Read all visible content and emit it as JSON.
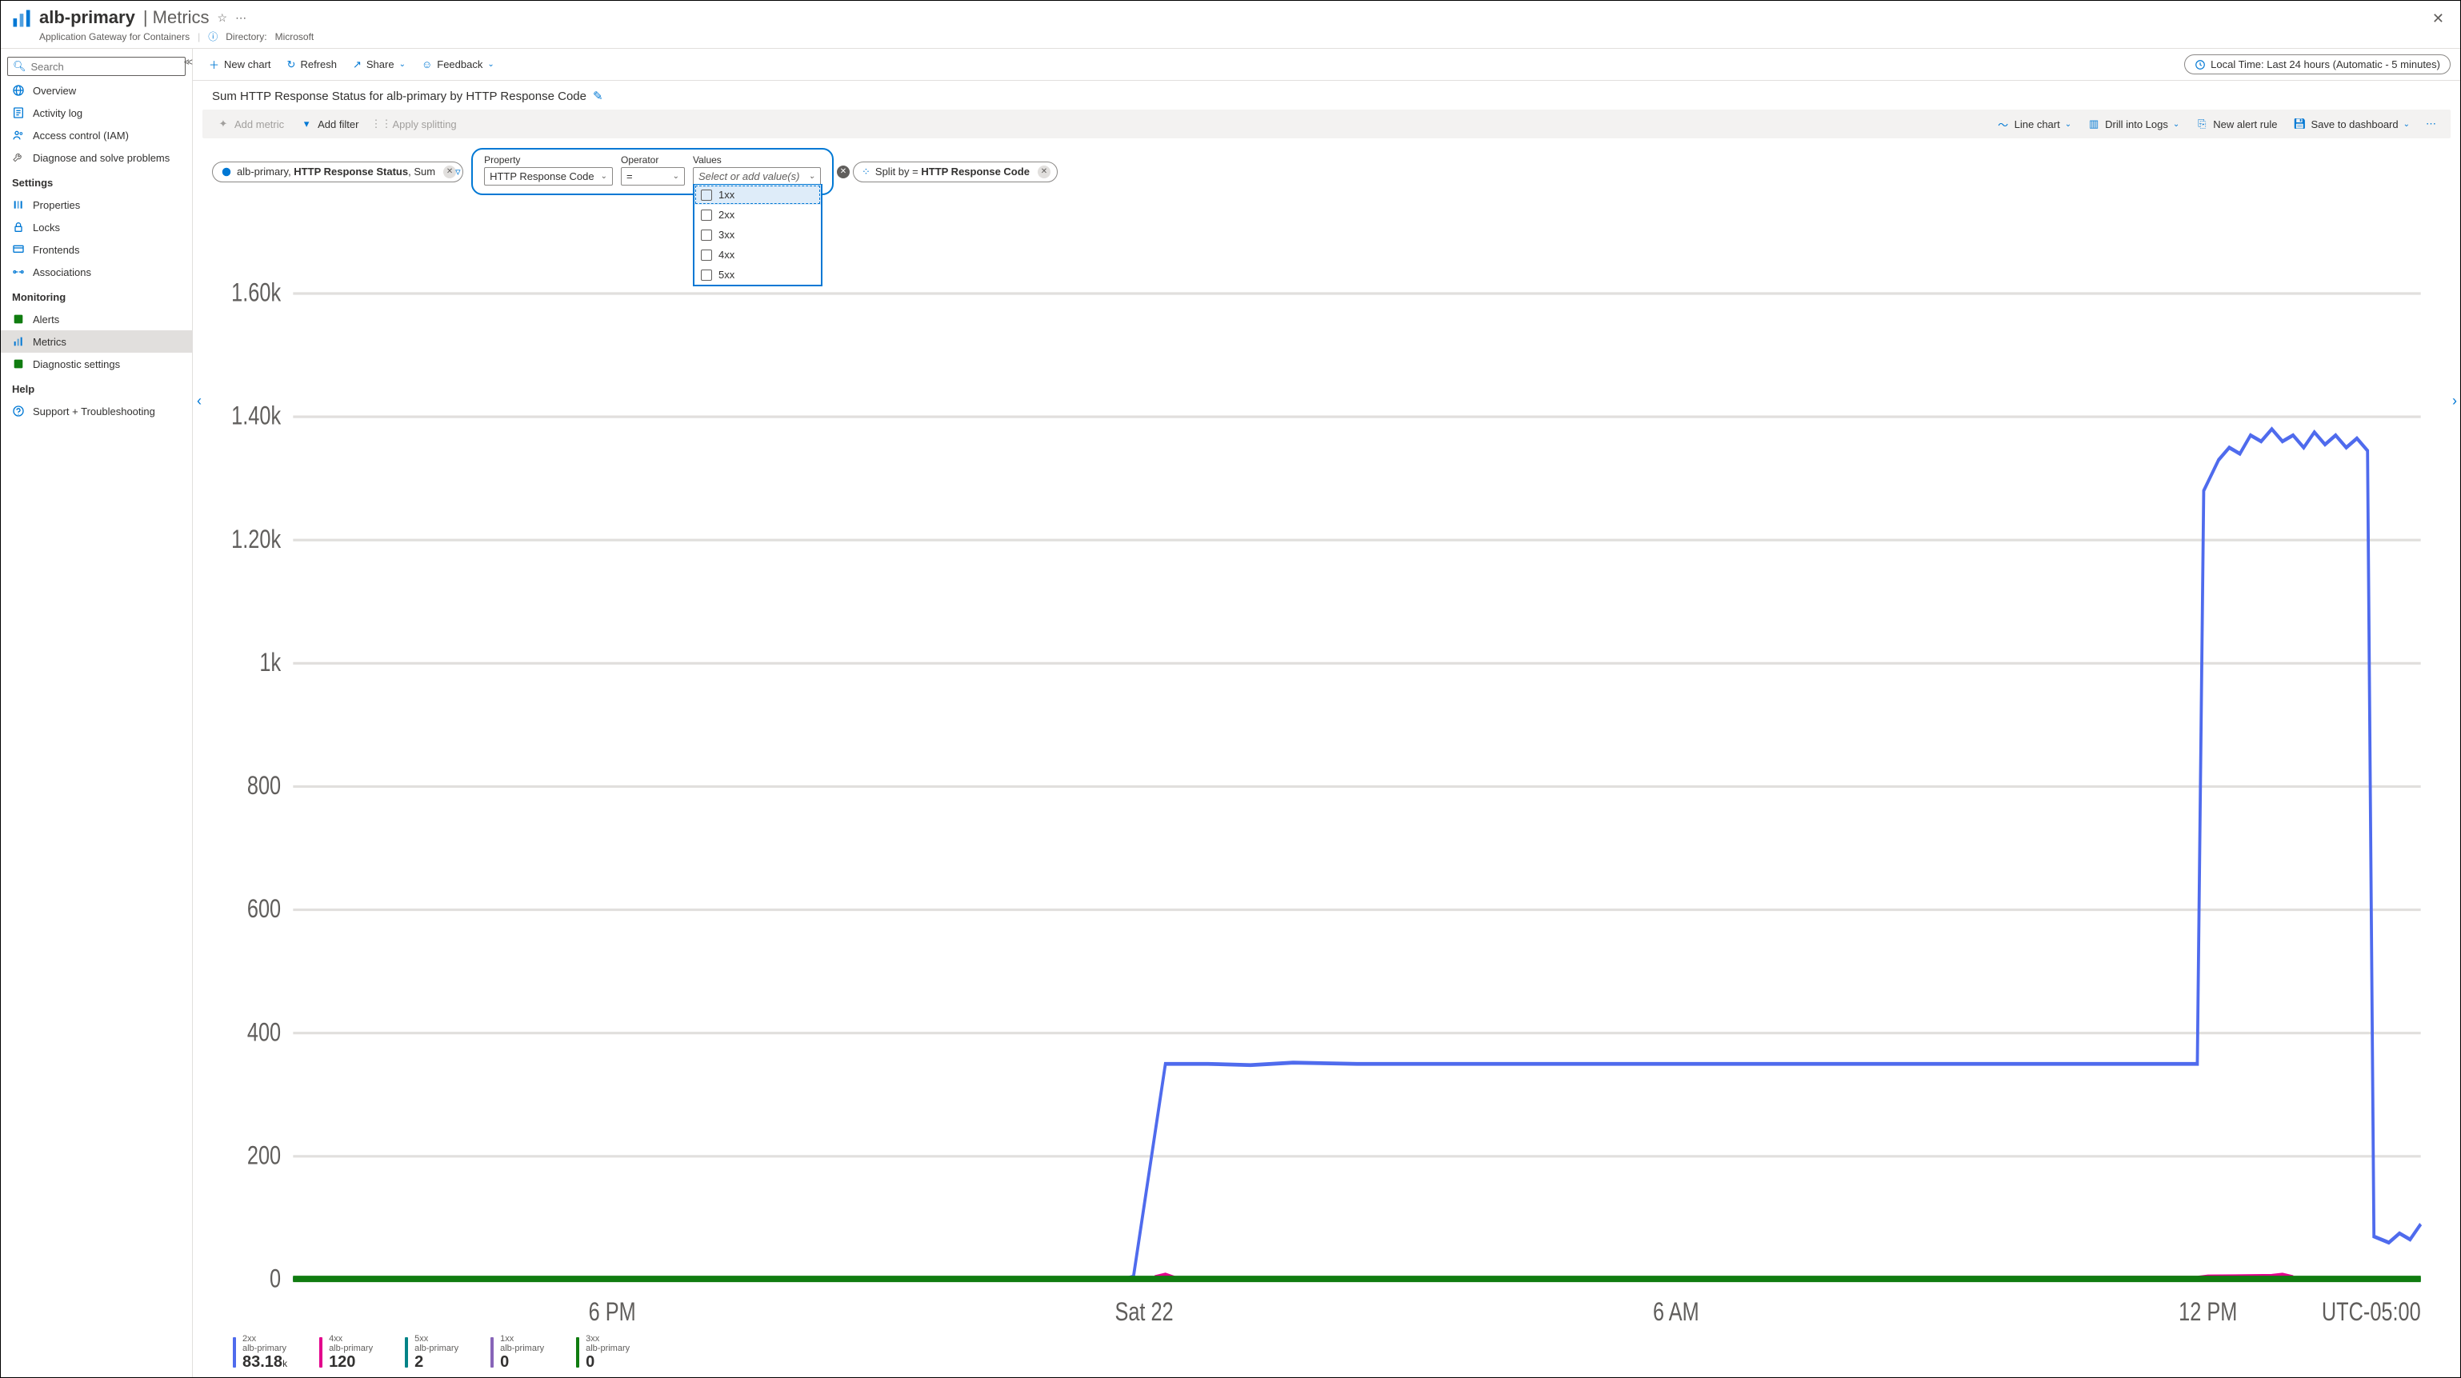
{
  "header": {
    "resource_name": "alb-primary",
    "section": "Metrics",
    "subtitle": "Application Gateway for Containers",
    "directory_label": "Directory:",
    "directory_value": "Microsoft"
  },
  "search": {
    "placeholder": "Search"
  },
  "sidebar": {
    "top": [
      {
        "label": "Overview",
        "icon": "globe",
        "color": "#0078d4"
      },
      {
        "label": "Activity log",
        "icon": "log",
        "color": "#0078d4"
      },
      {
        "label": "Access control (IAM)",
        "icon": "iam",
        "color": "#0078d4"
      },
      {
        "label": "Diagnose and solve problems",
        "icon": "wrench",
        "color": "#605e5c"
      }
    ],
    "settings_title": "Settings",
    "settings": [
      {
        "label": "Properties",
        "icon": "props",
        "color": "#0078d4"
      },
      {
        "label": "Locks",
        "icon": "lock",
        "color": "#0078d4"
      },
      {
        "label": "Frontends",
        "icon": "frontends",
        "color": "#0078d4"
      },
      {
        "label": "Associations",
        "icon": "assoc",
        "color": "#0078d4"
      }
    ],
    "monitoring_title": "Monitoring",
    "monitoring": [
      {
        "label": "Alerts",
        "icon": "alerts",
        "color": "#107c10"
      },
      {
        "label": "Metrics",
        "icon": "metrics",
        "color": "#0078d4",
        "active": true
      },
      {
        "label": "Diagnostic settings",
        "icon": "diag",
        "color": "#107c10"
      }
    ],
    "help_title": "Help",
    "help": [
      {
        "label": "Support + Troubleshooting",
        "icon": "support",
        "color": "#0078d4"
      }
    ]
  },
  "toolbar": {
    "new_chart": "New chart",
    "refresh": "Refresh",
    "share": "Share",
    "feedback": "Feedback",
    "time_range": "Local Time: Last 24 hours (Automatic - 5 minutes)"
  },
  "chart": {
    "title": "Sum HTTP Response Status for alb-primary by HTTP Response Code",
    "toolbar": {
      "add_metric": "Add metric",
      "add_filter": "Add filter",
      "apply_splitting": "Apply splitting",
      "line_chart": "Line chart",
      "drill_logs": "Drill into Logs",
      "new_alert": "New alert rule",
      "save_dashboard": "Save to dashboard"
    },
    "metric_pill": {
      "resource": "alb-primary",
      "metric": "HTTP Response Status",
      "agg": "Sum"
    },
    "split_pill_prefix": "Split by = ",
    "split_pill_value": "HTTP Response Code",
    "filter": {
      "property_label": "Property",
      "property_value": "HTTP Response Code",
      "operator_label": "Operator",
      "operator_value": "=",
      "values_label": "Values",
      "values_placeholder": "Select or add value(s)",
      "options": [
        "1xx",
        "2xx",
        "3xx",
        "4xx",
        "5xx"
      ]
    },
    "legend": [
      {
        "name": "2xx",
        "sub": "alb-primary",
        "value": "83.18",
        "unit": "k",
        "color": "#4f6bed"
      },
      {
        "name": "4xx",
        "sub": "alb-primary",
        "value": "120",
        "unit": "",
        "color": "#e3008c"
      },
      {
        "name": "5xx",
        "sub": "alb-primary",
        "value": "2",
        "unit": "",
        "color": "#038387"
      },
      {
        "name": "1xx",
        "sub": "alb-primary",
        "value": "0",
        "unit": "",
        "color": "#8764b8"
      },
      {
        "name": "3xx",
        "sub": "alb-primary",
        "value": "0",
        "unit": "",
        "color": "#107c10"
      }
    ]
  },
  "chart_data": {
    "type": "line",
    "ylabel": "",
    "xlabel": "",
    "ylim": [
      0,
      1700
    ],
    "y_ticks": [
      0,
      200,
      400,
      600,
      800,
      1000,
      1200,
      1400,
      1600
    ],
    "y_tick_labels": [
      "0",
      "200",
      "400",
      "600",
      "800",
      "1k",
      "1.20k",
      "1.40k",
      "1.60k"
    ],
    "x_ticks": [
      0.15,
      0.4,
      0.65,
      0.9
    ],
    "x_tick_labels": [
      "6 PM",
      "Sat 22",
      "6 AM",
      "12 PM"
    ],
    "tz_label": "UTC-05:00",
    "series": [
      {
        "name": "2xx",
        "color": "#4f6bed",
        "points": [
          [
            0.0,
            0
          ],
          [
            0.39,
            0
          ],
          [
            0.395,
            5
          ],
          [
            0.41,
            350
          ],
          [
            0.43,
            350
          ],
          [
            0.45,
            348
          ],
          [
            0.47,
            352
          ],
          [
            0.5,
            350
          ],
          [
            0.55,
            350
          ],
          [
            0.6,
            350
          ],
          [
            0.65,
            350
          ],
          [
            0.7,
            350
          ],
          [
            0.75,
            350
          ],
          [
            0.8,
            350
          ],
          [
            0.85,
            350
          ],
          [
            0.895,
            350
          ],
          [
            0.898,
            1280
          ],
          [
            0.905,
            1330
          ],
          [
            0.91,
            1350
          ],
          [
            0.915,
            1340
          ],
          [
            0.92,
            1370
          ],
          [
            0.925,
            1360
          ],
          [
            0.93,
            1380
          ],
          [
            0.935,
            1360
          ],
          [
            0.94,
            1370
          ],
          [
            0.945,
            1350
          ],
          [
            0.95,
            1375
          ],
          [
            0.955,
            1355
          ],
          [
            0.96,
            1370
          ],
          [
            0.965,
            1350
          ],
          [
            0.97,
            1365
          ],
          [
            0.975,
            1345
          ],
          [
            0.978,
            70
          ],
          [
            0.985,
            60
          ],
          [
            0.99,
            75
          ],
          [
            0.995,
            65
          ],
          [
            1.0,
            90
          ]
        ]
      },
      {
        "name": "4xx",
        "color": "#e3008c",
        "points": [
          [
            0.405,
            4
          ],
          [
            0.41,
            8
          ],
          [
            0.415,
            2
          ],
          [
            0.895,
            3
          ],
          [
            0.9,
            5
          ],
          [
            0.93,
            6
          ],
          [
            0.935,
            8
          ],
          [
            0.94,
            4
          ]
        ]
      },
      {
        "name": "5xx",
        "color": "#038387",
        "points": [
          [
            0,
            1
          ],
          [
            1,
            1
          ]
        ]
      },
      {
        "name": "1xx",
        "color": "#8764b8",
        "points": [
          [
            0,
            0
          ],
          [
            1,
            0
          ]
        ]
      },
      {
        "name": "3xx",
        "color": "#107c10",
        "points": [
          [
            0,
            2
          ],
          [
            1,
            2
          ]
        ]
      }
    ]
  }
}
